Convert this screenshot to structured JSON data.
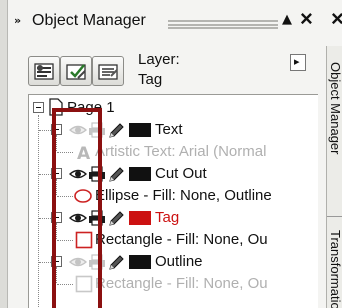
{
  "window": {
    "title": "Object Manager",
    "grip_glyph": "»",
    "collapse_glyph": "▲",
    "close_glyph": "×",
    "close_glyph_2": "×"
  },
  "toolbar": {
    "buttons": [
      {
        "icon": "show-object-properties-icon"
      },
      {
        "icon": "edit-across-layers-icon"
      },
      {
        "icon": "layer-manager-view-icon"
      }
    ],
    "layer_label": "Layer:",
    "layer_value": "Tag",
    "menu_glyph": "▸"
  },
  "tree": {
    "page": "Page 1",
    "rows": [
      {
        "kind": "layer",
        "label": "Text",
        "style": "normal"
      },
      {
        "kind": "object",
        "icon": "artistic-text-icon",
        "label": "Artistic Text: Arial (Normal",
        "style": "dim"
      },
      {
        "kind": "layer",
        "label": "Cut Out",
        "style": "normal"
      },
      {
        "kind": "object",
        "icon": "ellipse-icon",
        "label": "Ellipse - Fill: None, Outline",
        "style": "normal"
      },
      {
        "kind": "layer",
        "label": "Tag",
        "style": "red"
      },
      {
        "kind": "object",
        "icon": "rectangle-icon",
        "label": "Rectangle - Fill: None, Ou",
        "style": "normal"
      },
      {
        "kind": "layer",
        "label": "Outline",
        "style": "normal"
      },
      {
        "kind": "object",
        "icon": "rectangle-icon",
        "label": "Rectangle - Fill: None, Ou",
        "style": "dim"
      }
    ]
  },
  "right_tabs": {
    "tab1": "Object Manager",
    "tab2": "Transformations"
  },
  "colors": {
    "highlight": "#8b1010",
    "active_layer_text": "#cc1111",
    "layer_swatch": "#111111"
  }
}
